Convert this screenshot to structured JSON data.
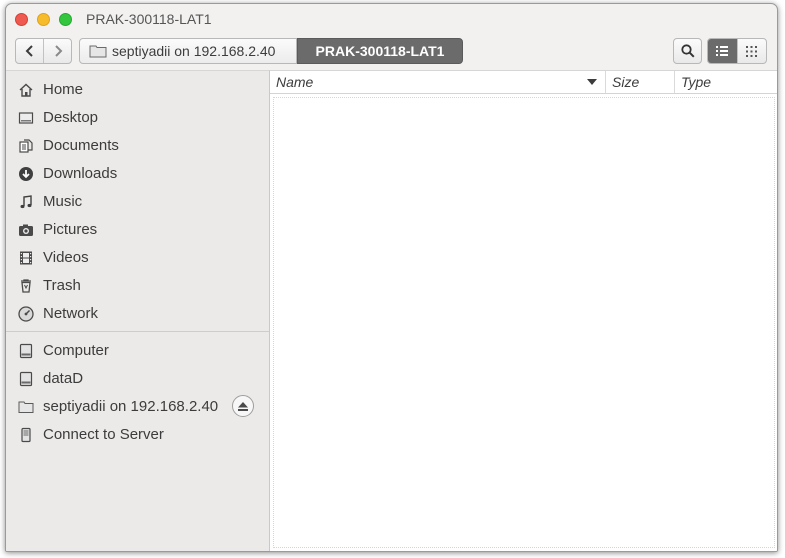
{
  "window": {
    "title": "PRAK-300118-LAT1"
  },
  "breadcrumb": {
    "parent": "septiyadii on 192.168.2.40",
    "current": "PRAK-300118-LAT1"
  },
  "sidebar": {
    "places": [
      {
        "label": "Home",
        "icon": "home-icon"
      },
      {
        "label": "Desktop",
        "icon": "desktop-icon"
      },
      {
        "label": "Documents",
        "icon": "documents-icon"
      },
      {
        "label": "Downloads",
        "icon": "downloads-icon"
      },
      {
        "label": "Music",
        "icon": "music-icon"
      },
      {
        "label": "Pictures",
        "icon": "pictures-icon"
      },
      {
        "label": "Videos",
        "icon": "videos-icon"
      },
      {
        "label": "Trash",
        "icon": "trash-icon"
      },
      {
        "label": "Network",
        "icon": "network-icon"
      }
    ],
    "devices": [
      {
        "label": "Computer",
        "icon": "computer-icon"
      },
      {
        "label": "dataD",
        "icon": "drive-icon"
      },
      {
        "label": "septiyadii on 192.168.2.40",
        "icon": "network-folder-icon"
      },
      {
        "label": "Connect to Server",
        "icon": "server-icon"
      }
    ]
  },
  "columns": {
    "name": "Name",
    "size": "Size",
    "type": "Type"
  },
  "colors": {
    "close": "#ee5a4f",
    "minimize": "#f7bc2c",
    "maximize": "#34c63f",
    "active_crumb": "#6b6b6b"
  }
}
